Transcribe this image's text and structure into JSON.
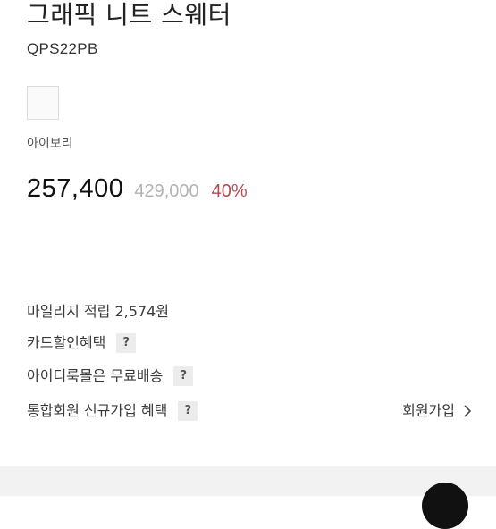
{
  "product": {
    "title": "그래픽 니트 스웨터",
    "code": "QPS22PB",
    "color_name": "아이보리",
    "price": "257,400",
    "original_price": "429,000",
    "discount": "40%"
  },
  "benefits": {
    "mileage": "마일리지 적립 2,574원",
    "card_discount": "카드할인혜택",
    "free_shipping": "아이디룩몰은 무료배송",
    "signup_benefit": "통합회원 신규가입 혜택",
    "help_label": "?",
    "join_label": "회원가입"
  },
  "colors": {
    "discount": "#b24b52",
    "original_price": "#b3b3b3",
    "help_bg": "#ececec"
  },
  "icons": {
    "join": "chevron-right-icon"
  }
}
